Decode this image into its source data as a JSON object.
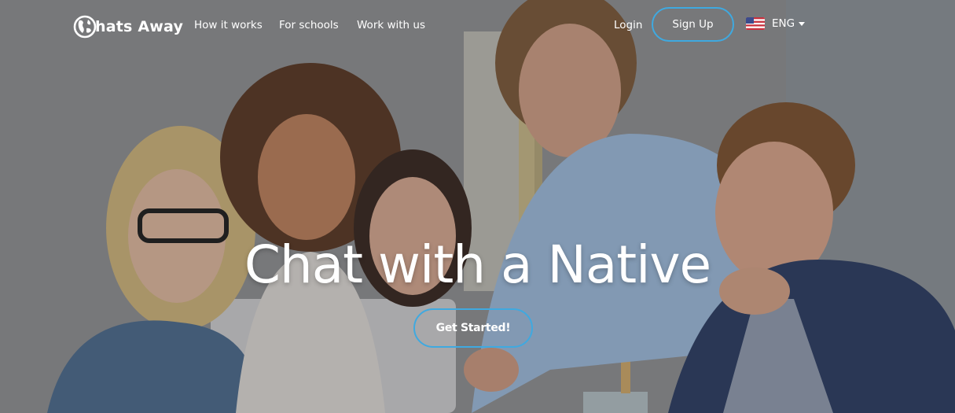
{
  "nav": {
    "brand": "hats Away",
    "links": [
      "How it works",
      "For schools",
      "Work with us"
    ],
    "login": "Login",
    "signup": "Sign Up",
    "language": "ENG"
  },
  "hero": {
    "headline": "Chat with a Native",
    "cta": "Get Started!"
  },
  "colors": {
    "accent": "#3fa9e0",
    "text": "#ffffff"
  },
  "icons": [
    "globe-logo-icon",
    "us-flag-icon",
    "caret-down-icon"
  ]
}
